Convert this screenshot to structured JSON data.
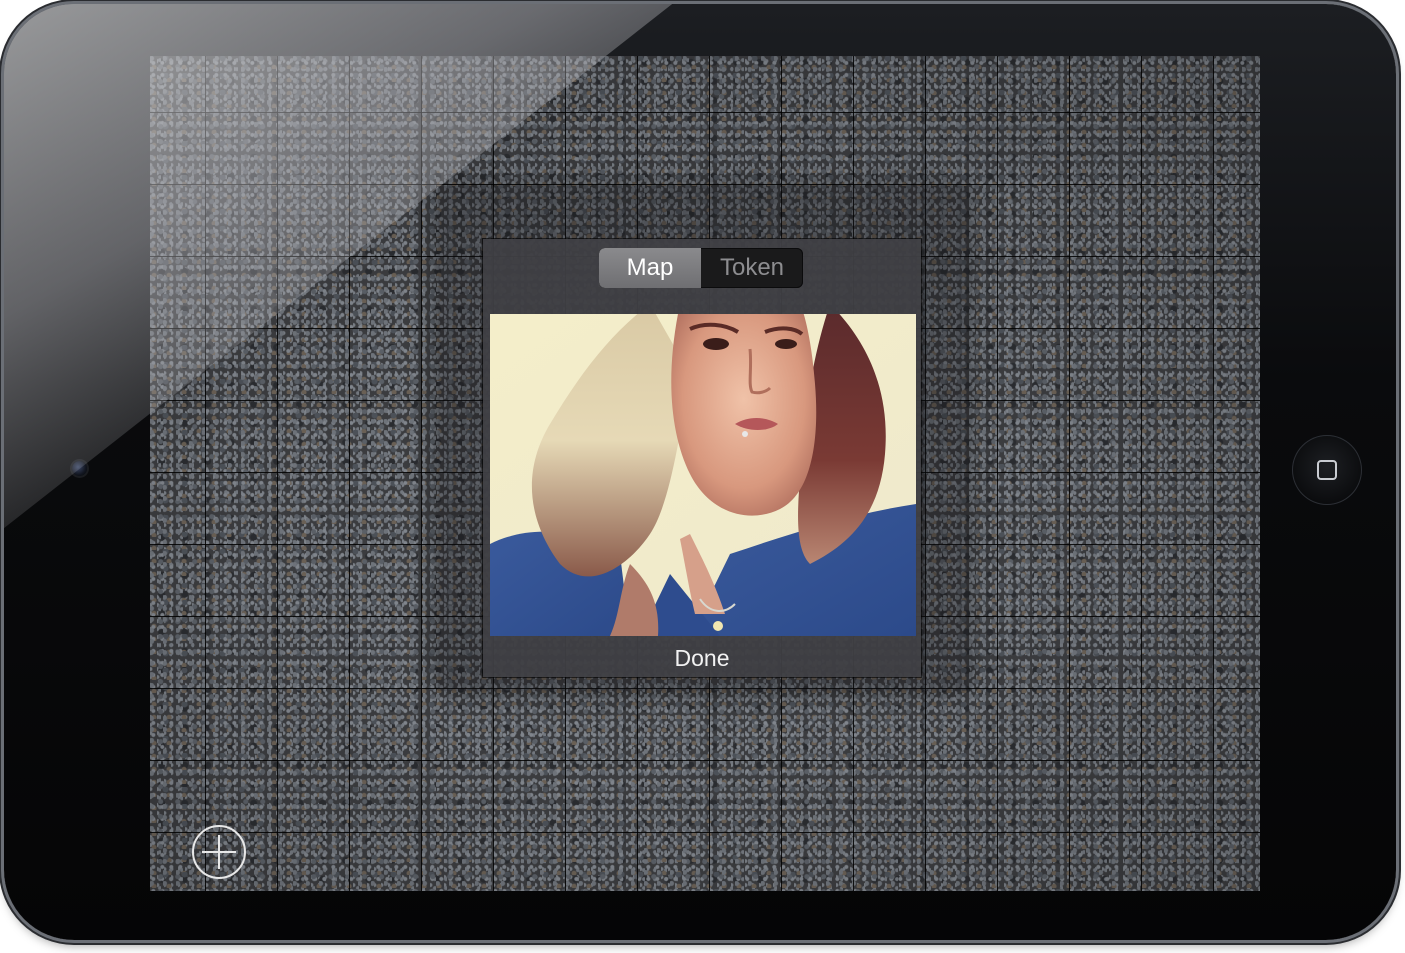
{
  "device": {
    "camera_icon": "front-camera",
    "home_icon": "home-square"
  },
  "screen": {
    "background": "gravel-texture-grid"
  },
  "popup": {
    "segments": [
      {
        "label": "Map",
        "selected": true
      },
      {
        "label": "Token",
        "selected": false
      }
    ],
    "photo_description_icon": "selected-photo",
    "done_label": "Done"
  },
  "toolbar": {
    "add_icon": "plus-circle-icon"
  },
  "colors": {
    "popup_bg": "#404044",
    "segment_active": "#7c7c7f",
    "segment_inactive": "#1a1a1b",
    "grid_line": "#000000"
  }
}
